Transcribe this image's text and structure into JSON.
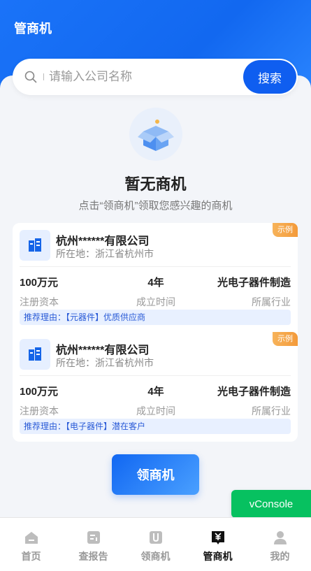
{
  "header": {
    "title": "管商机"
  },
  "search": {
    "placeholder": "请输入公司名称",
    "button_label": "搜索"
  },
  "empty_state": {
    "title": "暂无商机",
    "subtitle": "点击“领商机”领取您感兴趣的商机"
  },
  "cards": [
    {
      "company": "杭州******有限公司",
      "location": "所在地：浙江省杭州市",
      "badge": "示例",
      "capital_value": "100万元",
      "capital_label": "注册资本",
      "years_value": "4年",
      "years_label": "成立时间",
      "industry_value": "光电子器件制造",
      "industry_label": "所属行业",
      "reason": "推荐理由：【元器件】优质供应商"
    },
    {
      "company": "杭州******有限公司",
      "location": "所在地：浙江省杭州市",
      "badge": "示例",
      "capital_value": "100万元",
      "capital_label": "注册资本",
      "years_value": "4年",
      "years_label": "成立时间",
      "industry_value": "光电子器件制造",
      "industry_label": "所属行业",
      "reason": "推荐理由：【电子器件】潜在客户"
    }
  ],
  "claim_button": "领商机",
  "vconsole": "vConsole",
  "tabs": [
    {
      "label": "首页",
      "icon": "home-icon"
    },
    {
      "label": "查报告",
      "icon": "report-icon"
    },
    {
      "label": "领商机",
      "icon": "claim-icon"
    },
    {
      "label": "管商机",
      "icon": "manage-icon"
    },
    {
      "label": "我的",
      "icon": "user-icon"
    }
  ],
  "active_tab": "管商机",
  "colors": {
    "primary": "#0f5ef0",
    "badge": "#f39a3a",
    "vconsole": "#07c160"
  }
}
